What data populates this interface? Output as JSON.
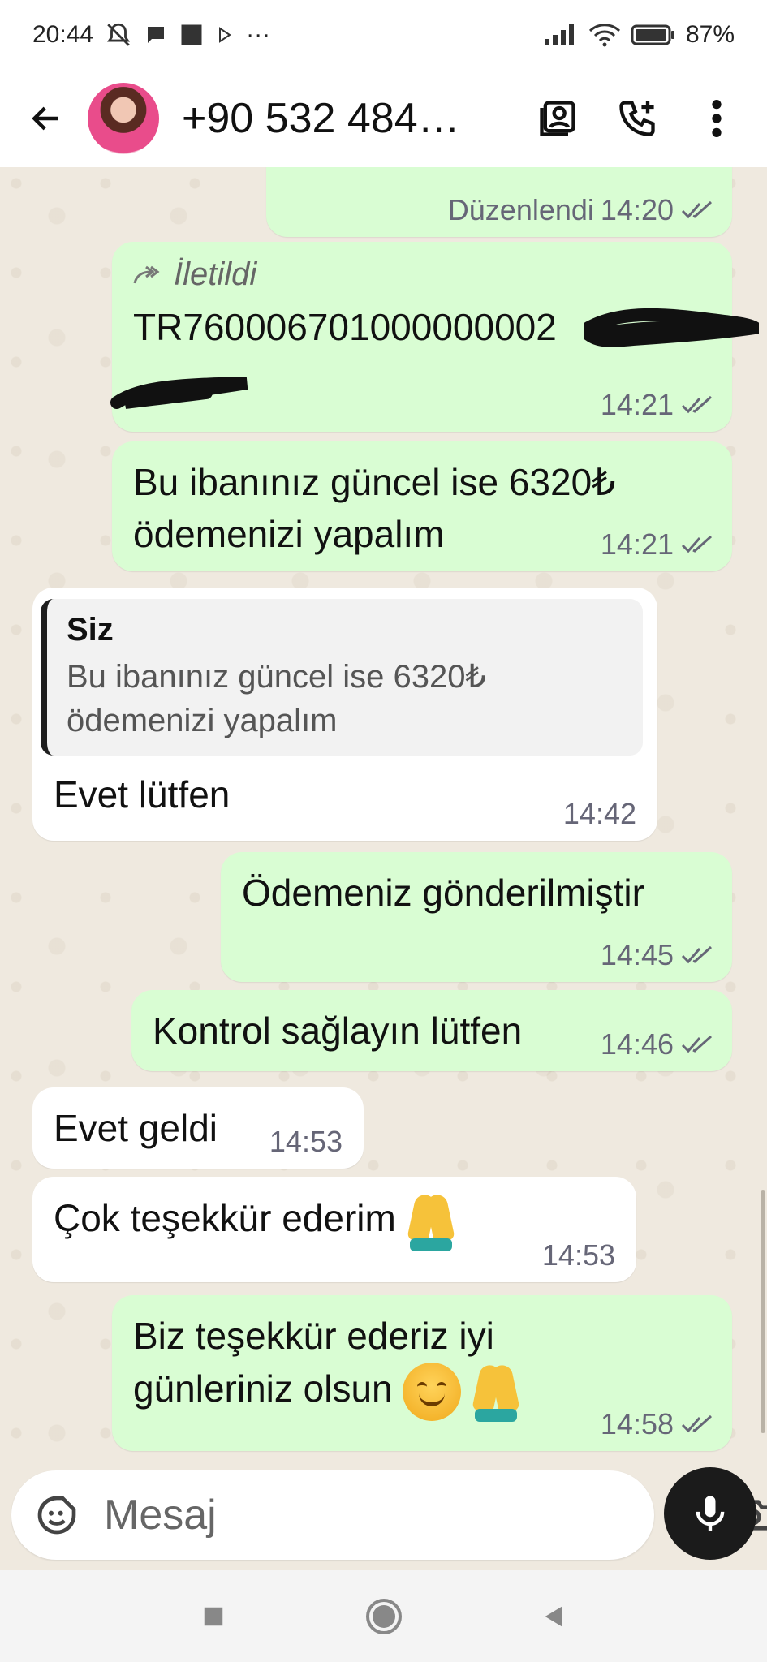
{
  "status_bar": {
    "time": "20:44",
    "battery": "87%",
    "more": "···"
  },
  "header": {
    "title": "+90 532 484…"
  },
  "messages": {
    "edited": {
      "label": "Düzenlendi",
      "time": "14:20"
    },
    "forwarded": {
      "label": "İletildi",
      "text": "TR760006701000000002",
      "time": "14:21"
    },
    "iban_msg": {
      "line1": "Bu ibanınız güncel ise 6320₺",
      "line2": "ödemenizi yapalım",
      "time": "14:21"
    },
    "reply": {
      "quote_name": "Siz",
      "quote_line1": "Bu ibanınız güncel ise 6320₺",
      "quote_line2": "ödemenizi yapalım",
      "text": "Evet lütfen",
      "time": "14:42"
    },
    "sent_payment": {
      "text": "Ödemeniz gönderilmiştir",
      "time": "14:45"
    },
    "check": {
      "text": "Kontrol sağlayın lütfen",
      "time": "14:46"
    },
    "received": {
      "text": "Evet geldi",
      "time": "14:53"
    },
    "thanks": {
      "text": "Çok teşekkür ederim",
      "time": "14:53"
    },
    "final": {
      "line1": "Biz teşekkür ederiz iyi",
      "line2": "günleriniz olsun",
      "time": "14:58"
    }
  },
  "composer": {
    "placeholder": "Mesaj"
  },
  "colors": {
    "outgoing": "#d9fdd3",
    "incoming": "#ffffff",
    "background": "#efe9df",
    "mic": "#1b1b1b"
  }
}
